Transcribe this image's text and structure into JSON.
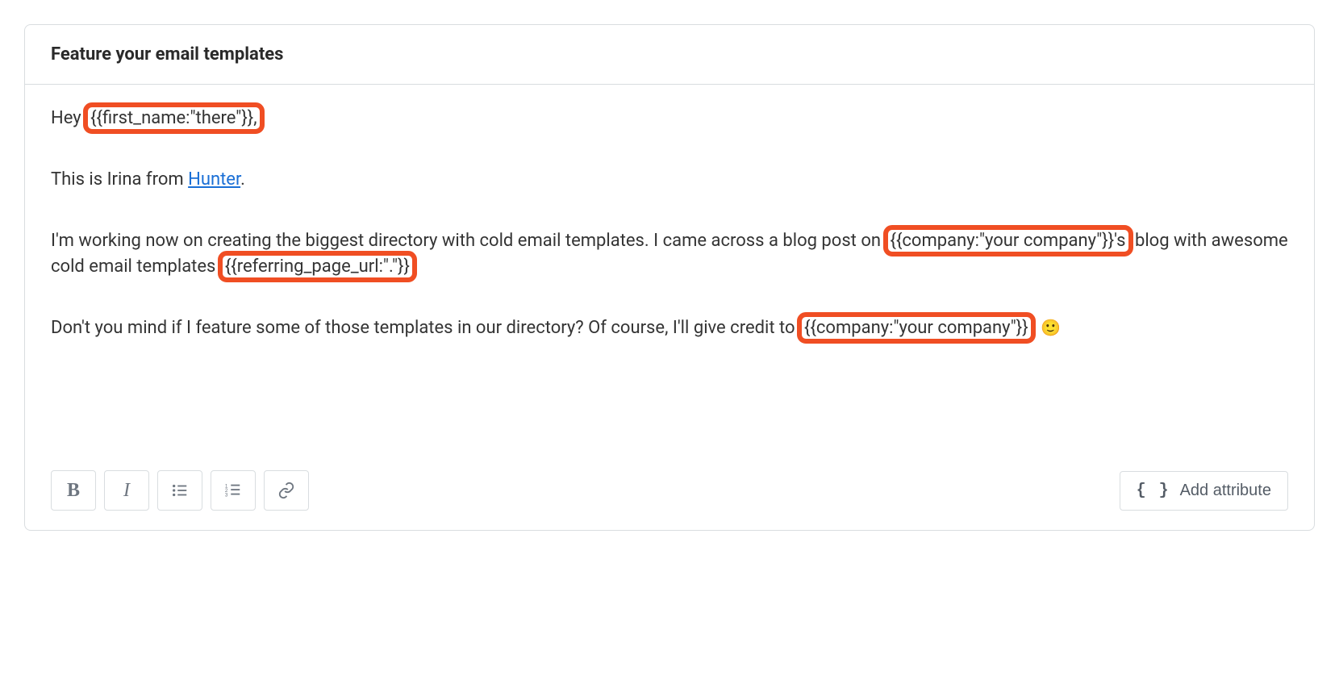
{
  "subject": "Feature your email templates",
  "body": {
    "greeting_pre": "Hey ",
    "attr_first_name": "{{first_name:\"there\"}},",
    "intro_pre": "This is Irina from ",
    "intro_link": "Hunter",
    "intro_post": ".",
    "p2_a": "I'm working now on creating the biggest directory with cold email templates. I came across a blog post on ",
    "attr_company1": "{{company:\"your company\"}}'s",
    "p2_b": " blog with awesome cold email templates ",
    "attr_refpage": "{{referring_page_url:\".\"}}",
    "p3_a": "Don't you mind if I feature some of those templates in our directory? Of course, I'll give credit to ",
    "attr_company2": "{{company:\"your company\"}}",
    "emoji": "🙂"
  },
  "toolbar": {
    "bold": "B",
    "italic": "I",
    "add_attribute": "Add attribute"
  }
}
